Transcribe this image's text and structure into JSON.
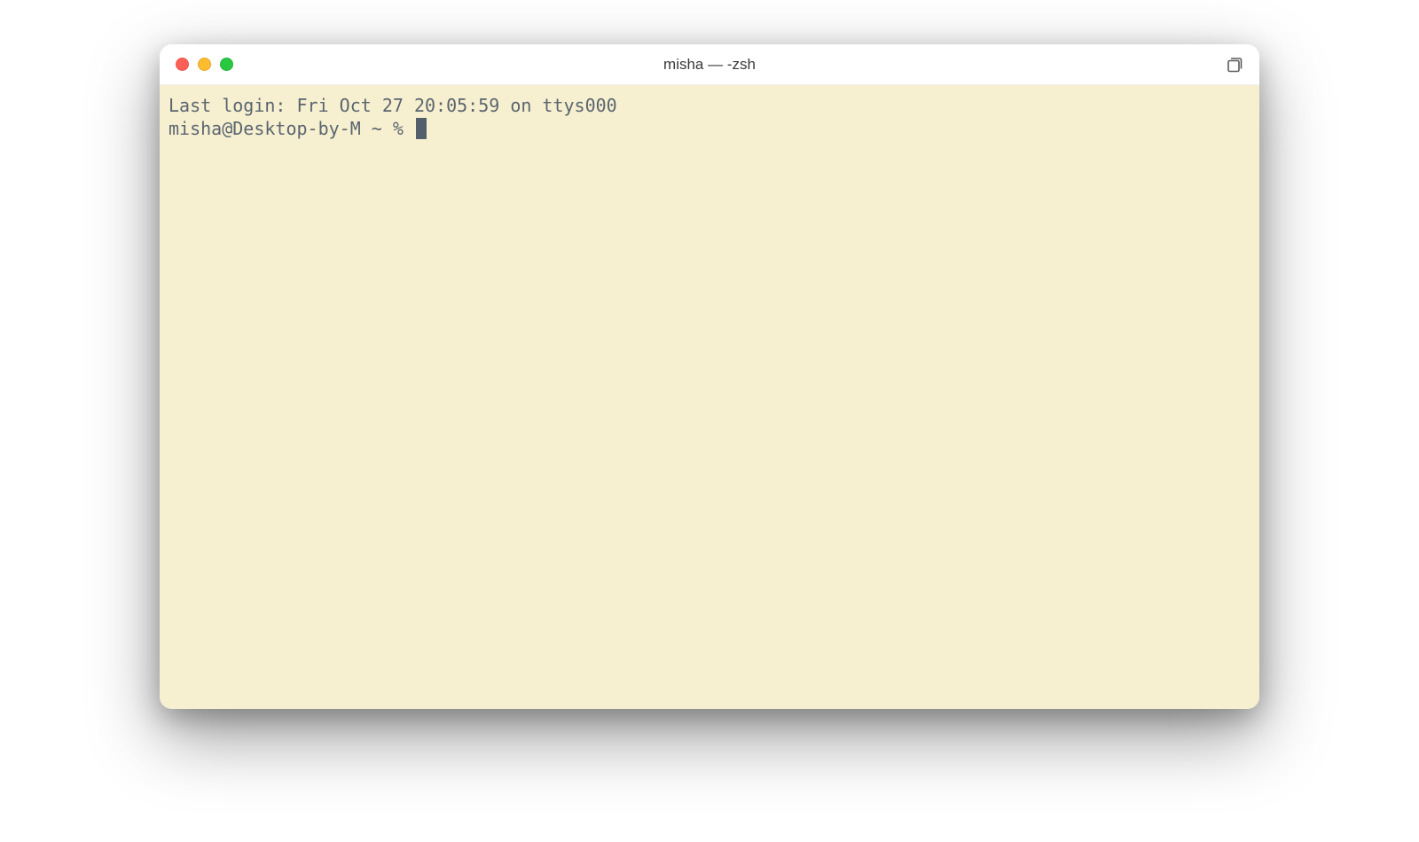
{
  "window": {
    "title": "misha — -zsh"
  },
  "terminal": {
    "last_login_line": "Last login: Fri Oct 27 20:05:59 on ttys000",
    "prompt": "misha@Desktop-by-M ~ % "
  },
  "colors": {
    "terminal_bg": "#f7f0d0",
    "terminal_text": "#5a6570",
    "close": "#ff5f57",
    "minimize": "#febc2e",
    "maximize": "#28c840"
  }
}
